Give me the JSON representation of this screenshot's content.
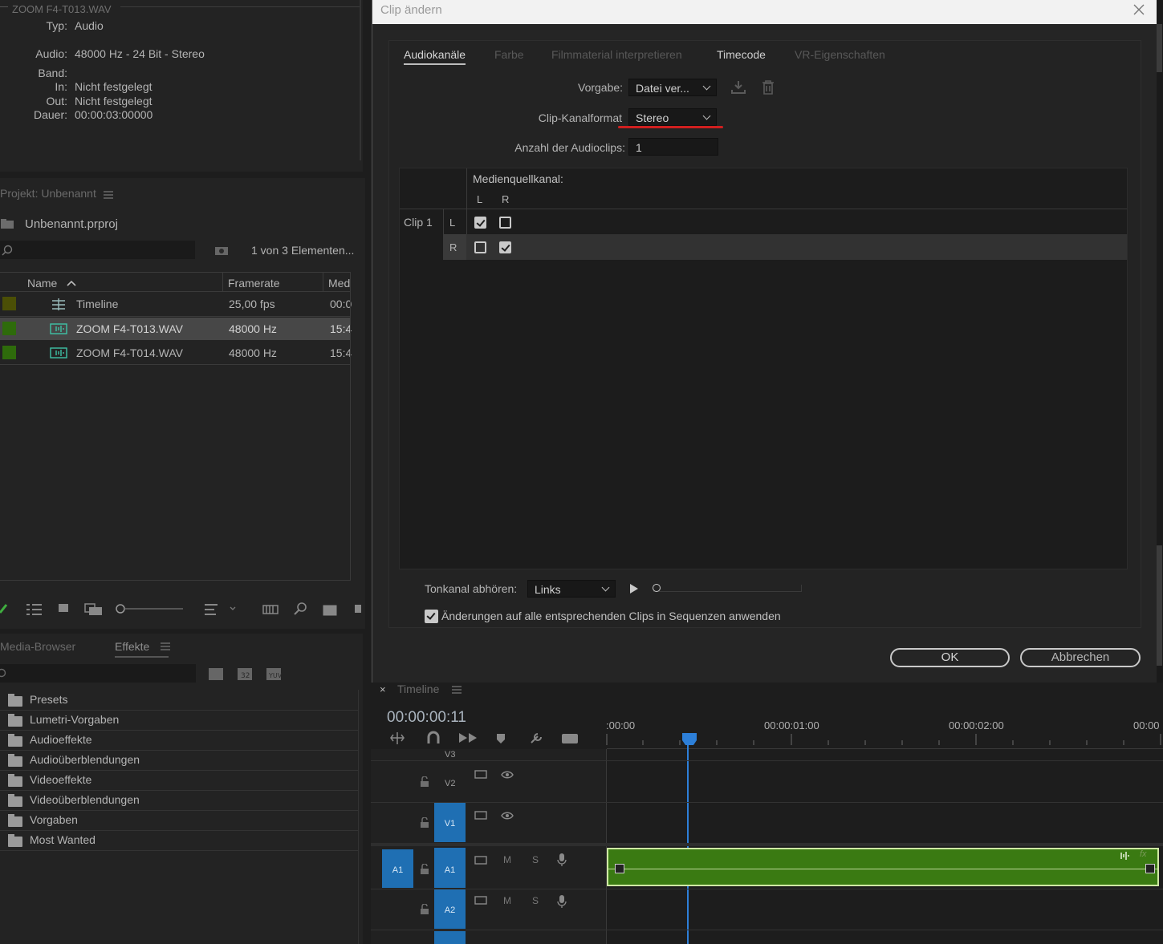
{
  "info_panel": {
    "title": "ZOOM F4-T013.WAV",
    "rows": [
      {
        "key": "Typ:",
        "value": "Audio"
      },
      {
        "key": "Audio:",
        "value": "48000 Hz - 24 Bit - Stereo"
      },
      {
        "key": "Band:",
        "value": ""
      },
      {
        "key": "In:",
        "value": "Nicht festgelegt"
      },
      {
        "key": "Out:",
        "value": "Nicht festgelegt"
      },
      {
        "key": "Dauer:",
        "value": "00:00:03:00000"
      }
    ]
  },
  "project_panel": {
    "tab": "Projekt: Unbenannt",
    "file": "Unbenannt.prproj",
    "count": "1 von 3 Elementen...",
    "columns": [
      "Name",
      "Framerate",
      "Med"
    ],
    "items": [
      {
        "name": "Timeline",
        "framerate": "25,00 fps",
        "media": "00:0",
        "color": "#4b4f06",
        "icon": "sequence-icon"
      },
      {
        "name": "ZOOM F4-T013.WAV",
        "framerate": "48000  Hz",
        "media": "15:4",
        "color": "#2e6b0b",
        "icon": "audio-file-icon"
      },
      {
        "name": "ZOOM F4-T014.WAV",
        "framerate": "48000  Hz",
        "media": "15:4",
        "color": "#2e6b0b",
        "icon": "audio-file-icon"
      }
    ]
  },
  "effects_panel": {
    "tabs": [
      "Media-Browser",
      "Effekte"
    ],
    "items": [
      "Presets",
      "Lumetri-Vorgaben",
      "Audioeffekte",
      "Audioüberblendungen",
      "Videoeffekte",
      "Videoüberblendungen",
      "Vorgaben",
      "Most Wanted"
    ]
  },
  "dialog": {
    "title": "Clip ändern",
    "tabs": [
      "Audiokanäle",
      "Farbe",
      "Filmmaterial interpretieren",
      "Timecode",
      "VR-Eigenschaften"
    ],
    "preset_label": "Vorgabe:",
    "preset_value": "Datei ver...",
    "format_label": "Clip-Kanalformat",
    "format_value": "Stereo",
    "clips_label": "Anzahl der Audioclips:",
    "clips_value": "1",
    "source_label": "Medienquellkanal:",
    "col_l": "L",
    "col_r": "R",
    "clip_name": "Clip 1",
    "row_l": "L",
    "row_r": "R",
    "listen_label": "Tonkanal abhören:",
    "listen_value": "Links",
    "apply_label": "Änderungen auf alle entsprechenden Clips in Sequenzen anwenden",
    "ok": "OK",
    "cancel": "Abbrechen",
    "accent": "#d01f1f"
  },
  "timeline": {
    "title": "Timeline",
    "timecode": "00:00:00:11",
    "ruler": [
      ":00:00",
      "00:00:01:00",
      "00:00:02:00",
      "00:00"
    ],
    "tracks": [
      {
        "name": "V3"
      },
      {
        "name": "V2"
      },
      {
        "name": "V1"
      },
      {
        "name": "A1",
        "source": "A1",
        "m": "M",
        "s": "S"
      },
      {
        "name": "A2",
        "m": "M",
        "s": "S"
      }
    ],
    "clip_color": "#3a7a12",
    "playhead_color": "#2d7fd8"
  }
}
